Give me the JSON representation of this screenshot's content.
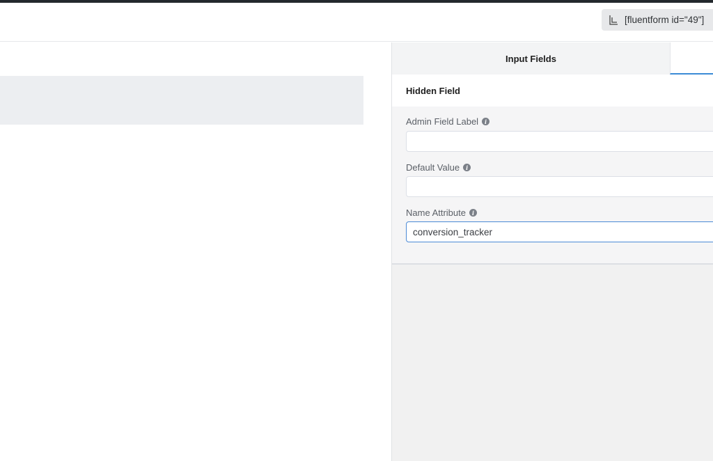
{
  "header": {
    "shortcode": "[fluentform id=\"49\"]"
  },
  "sidebar": {
    "tabs": [
      {
        "label": "Input Fields"
      },
      {
        "label": ""
      }
    ],
    "panel": {
      "title": "Hidden Field",
      "fields": [
        {
          "label": "Admin Field Label",
          "value": "",
          "placeholder": ""
        },
        {
          "label": "Default Value",
          "value": "",
          "placeholder": ""
        },
        {
          "label": "Name Attribute",
          "value": "conversion_tracker",
          "placeholder": ""
        }
      ]
    }
  },
  "icons": {
    "copy": "copy-icon",
    "info": "info-icon",
    "info_glyph": "i"
  },
  "colors": {
    "accent": "#3b8bd6",
    "topbar": "#23282d"
  }
}
